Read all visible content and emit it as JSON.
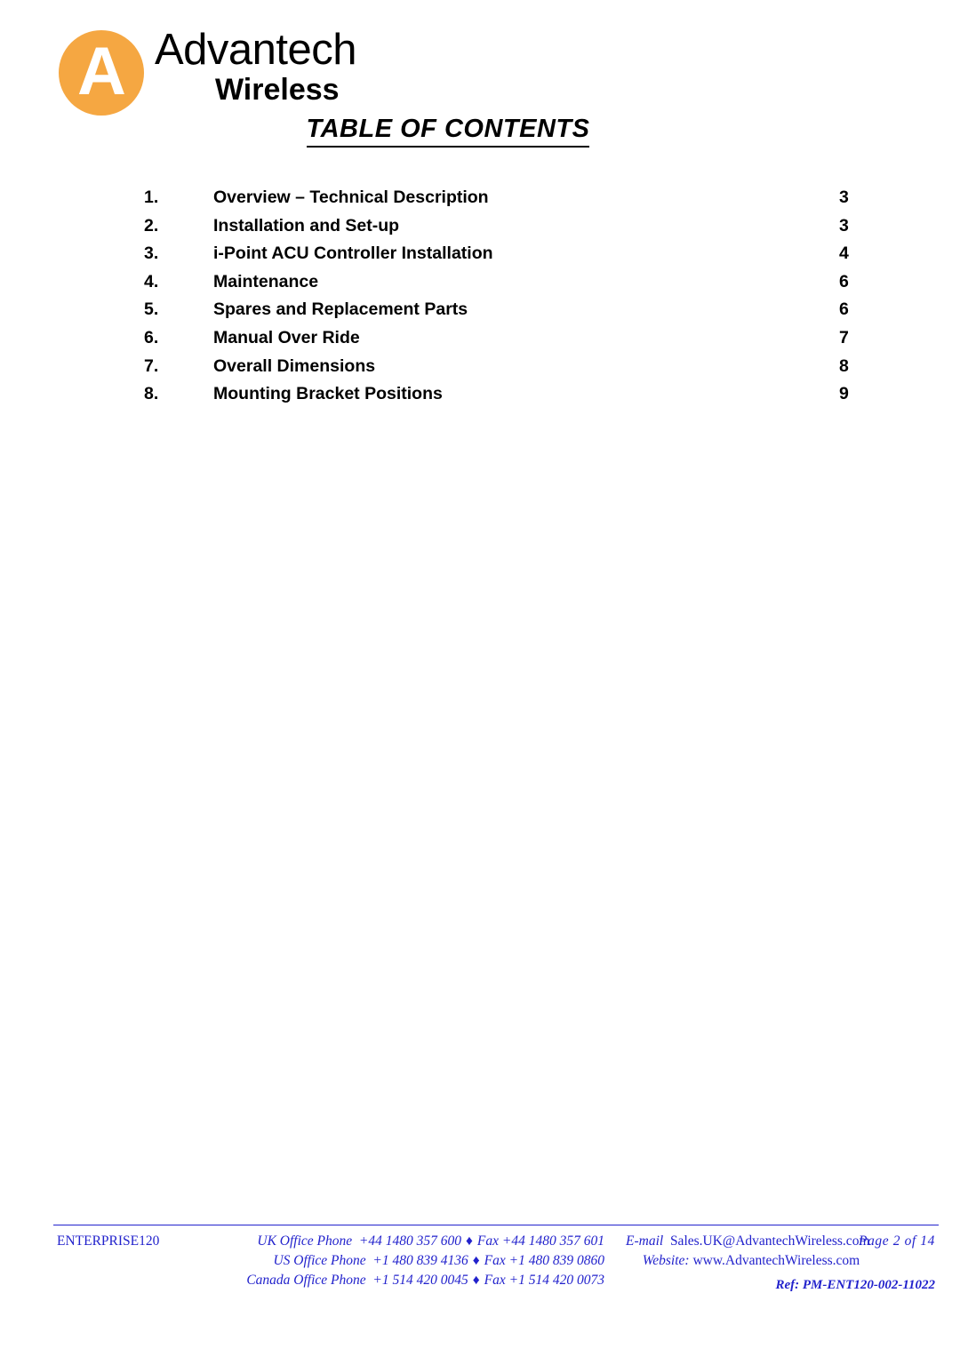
{
  "brand": {
    "logo_letter": "A",
    "name": "Advantech",
    "subname": "Wireless",
    "logo_color": "#f5a742"
  },
  "page": {
    "title": "TABLE OF CONTENTS"
  },
  "toc": {
    "entries": [
      {
        "num": "1.",
        "label": "Overview – Technical Description",
        "page": "3"
      },
      {
        "num": "2.",
        "label": "Installation and Set-up",
        "page": "3"
      },
      {
        "num": "3.",
        "label": "i-Point ACU Controller Installation",
        "page": "4"
      },
      {
        "num": "4.",
        "label": "Maintenance",
        "page": "6"
      },
      {
        "num": "5.",
        "label": "Spares and Replacement Parts",
        "page": "6"
      },
      {
        "num": "6.",
        "label": "Manual Over Ride",
        "page": "7"
      },
      {
        "num": "7.",
        "label": "Overall Dimensions",
        "page": "8"
      },
      {
        "num": "8.",
        "label": "Mounting Bracket Positions",
        "page": "9"
      }
    ]
  },
  "footer": {
    "color": "#2222cc",
    "doc_code": "ENTERPRISE120",
    "contacts": [
      {
        "label": "UK Office Phone",
        "phone": "+44 1480 357 600",
        "sep": "♦",
        "fax_label": "Fax",
        "fax": "+44 1480 357 601"
      },
      {
        "label": "US Office Phone",
        "phone": "+1 480 839 4136",
        "sep": "♦",
        "fax_label": "Fax",
        "fax": "+1 480 839 0860"
      },
      {
        "label": "Canada Office Phone",
        "phone": "+1 514 420 0045",
        "sep": "♦",
        "fax_label": "Fax",
        "fax": "+1 514 420 0073"
      }
    ],
    "email_label": "E-mail",
    "email": "Sales.UK@AdvantechWireless.com",
    "website_label": "Website:",
    "website": "www.AdvantechWireless.com",
    "page_indicator": "Page  2  of  14",
    "ref": "Ref: PM-ENT120-002-11022"
  }
}
